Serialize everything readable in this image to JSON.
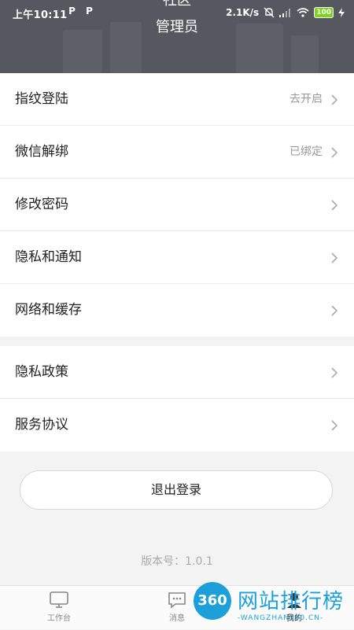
{
  "status_bar": {
    "time": "上午10:11",
    "p1": "P",
    "p2": "P",
    "speed": "2.1K/s",
    "battery": "100"
  },
  "header": {
    "title_partial": "社区",
    "title": "管理员"
  },
  "settings_group1": [
    {
      "label": "指纹登陆",
      "value": "去开启"
    },
    {
      "label": "微信解绑",
      "value": "已绑定"
    },
    {
      "label": "修改密码",
      "value": ""
    },
    {
      "label": "隐私和通知",
      "value": ""
    },
    {
      "label": "网络和缓存",
      "value": ""
    }
  ],
  "settings_group2": [
    {
      "label": "隐私政策",
      "value": ""
    },
    {
      "label": "服务协议",
      "value": ""
    }
  ],
  "logout_label": "退出登录",
  "version": "版本号：1.0.1",
  "tabbar": {
    "workbench": "工作台",
    "messages": "消息",
    "mine": "我的"
  },
  "watermark": {
    "logo": "360",
    "title": "网站排行榜",
    "subtitle": "-WANGZHAN360.CN-"
  },
  "colors": {
    "header_bg": "#55585f",
    "accent": "#1d9fd9",
    "battery": "#7ed321"
  }
}
